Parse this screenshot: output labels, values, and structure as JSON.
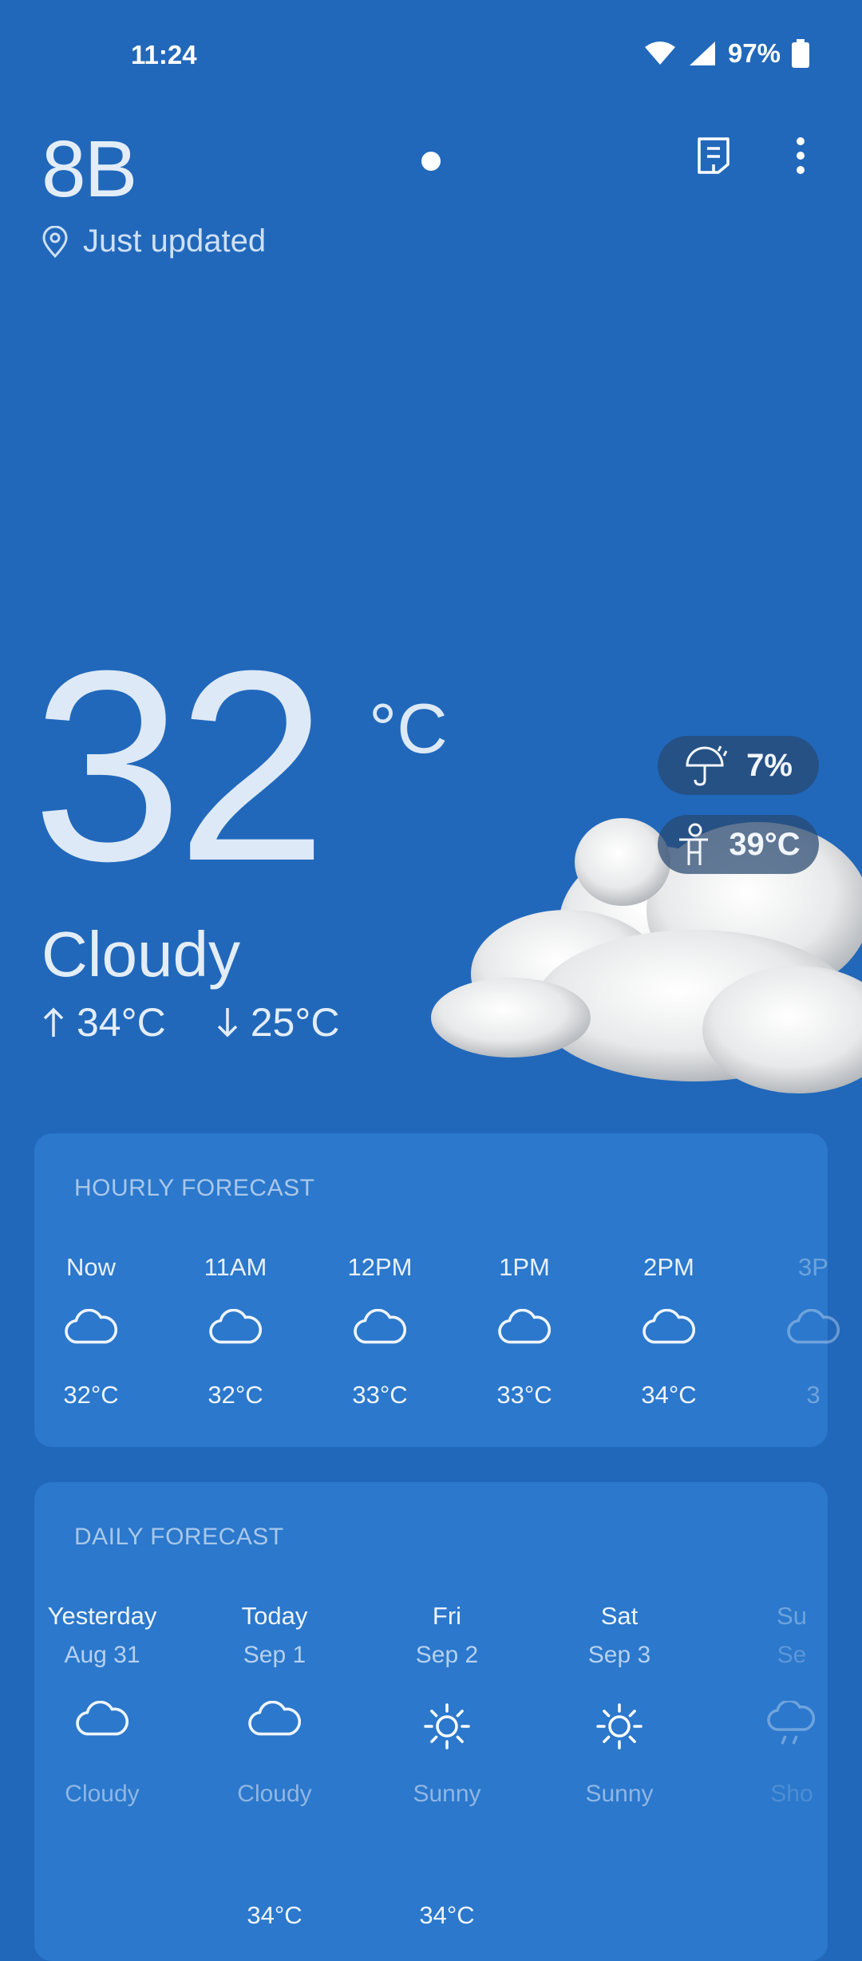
{
  "status": {
    "time": "11:24",
    "battery": "97%"
  },
  "header": {
    "location": "8B",
    "updated": "Just updated"
  },
  "current": {
    "temp": "32",
    "unit": "°C",
    "condition": "Cloudy",
    "high": "34°C",
    "low": "25°C",
    "precipitation": "7%",
    "feels_like": "39°C"
  },
  "hourly": {
    "title": "HOURLY FORECAST",
    "items": [
      {
        "time": "Now",
        "temp": "32°C",
        "icon": "cloud-icon"
      },
      {
        "time": "11AM",
        "temp": "32°C",
        "icon": "cloud-icon"
      },
      {
        "time": "12PM",
        "temp": "33°C",
        "icon": "cloud-icon"
      },
      {
        "time": "1PM",
        "temp": "33°C",
        "icon": "cloud-icon"
      },
      {
        "time": "2PM",
        "temp": "34°C",
        "icon": "cloud-icon"
      },
      {
        "time": "3P",
        "temp": "3",
        "icon": "cloud-icon"
      }
    ]
  },
  "daily": {
    "title": "DAILY FORECAST",
    "items": [
      {
        "day": "Yesterday",
        "date": "Aug 31",
        "condition": "Cloudy",
        "icon": "cloud-icon",
        "high": ""
      },
      {
        "day": "Today",
        "date": "Sep 1",
        "condition": "Cloudy",
        "icon": "cloud-icon",
        "high": "34°C"
      },
      {
        "day": "Fri",
        "date": "Sep 2",
        "condition": "Sunny",
        "icon": "sun-icon",
        "high": "34°C"
      },
      {
        "day": "Sat",
        "date": "Sep 3",
        "condition": "Sunny",
        "icon": "sun-icon",
        "high": ""
      },
      {
        "day": "Su",
        "date": "Se",
        "condition": "Sho",
        "icon": "rain-icon",
        "high": ""
      }
    ]
  }
}
